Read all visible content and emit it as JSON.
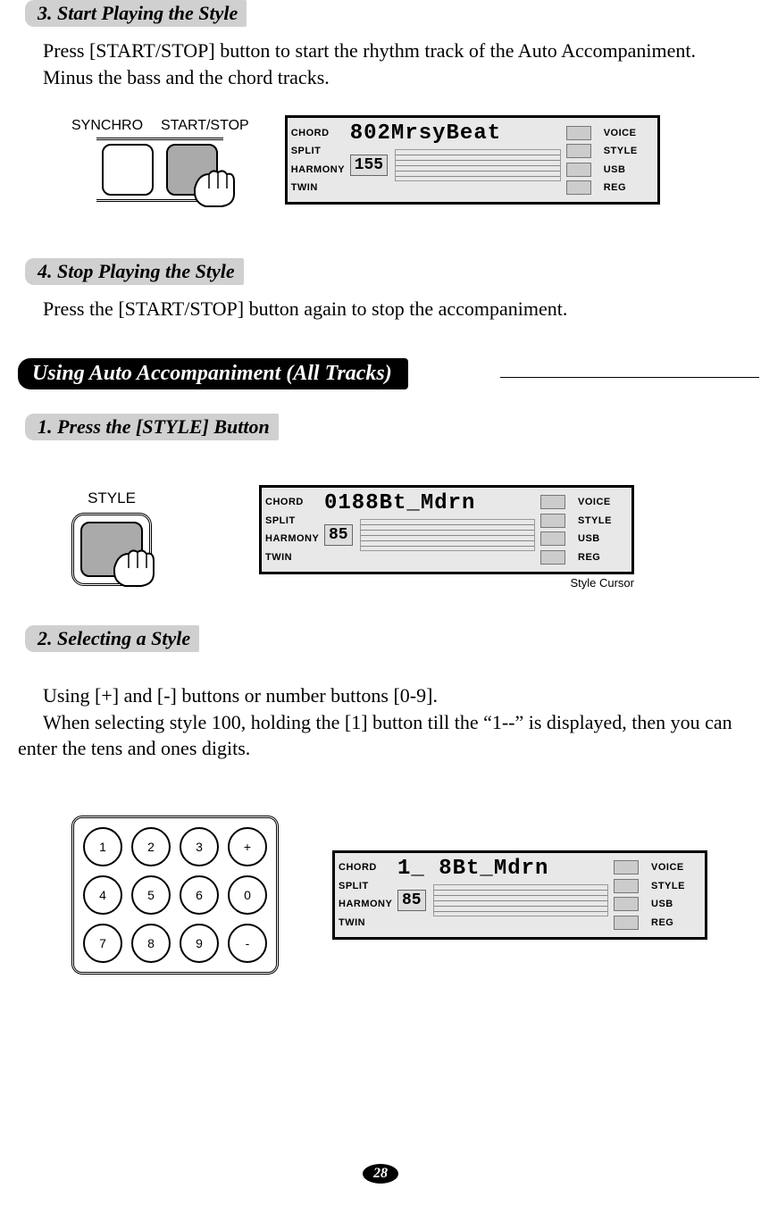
{
  "headings": {
    "h3": "3. Start Playing the Style",
    "h4": "4. Stop Playing the Style",
    "section": "Using Auto Accompaniment (All Tracks)",
    "h1b": "1. Press the [STYLE] Button",
    "h2b": "2. Selecting a Style"
  },
  "paragraphs": {
    "p3": "Press [START/STOP] button to start the rhythm track of the Auto Accompaniment. Minus the bass and the chord tracks.",
    "p4": "Press the [START/STOP] button again to stop the accompaniment.",
    "p2b_a": "Using [+] and [-] buttons or number buttons [0-9].",
    "p2b_b": "When selecting style 100, holding the [1] button till the “1--” is displayed, then you can enter the tens and ones digits."
  },
  "labels": {
    "synchro": "SYNCHRO",
    "startstop": "START/STOP",
    "style": "STYLE",
    "styleCursor": "Style Cursor"
  },
  "lcd": {
    "left": [
      "CHORD",
      "SPLIT",
      "HARMONY",
      "TWIN"
    ],
    "right": [
      "VOICE",
      "STYLE",
      "USB",
      "REG"
    ],
    "screen1_main": "802MrsyBeat",
    "screen1_tempo": "155",
    "screen2_main": "0188Bt_Mdrn",
    "screen2_tempo": "85",
    "screen3_main": "1_ 8Bt_Mdrn",
    "screen3_tempo": "85"
  },
  "keypad": [
    "1",
    "2",
    "3",
    "+",
    "4",
    "5",
    "6",
    "0",
    "7",
    "8",
    "9",
    "-"
  ],
  "pageNumber": "28"
}
